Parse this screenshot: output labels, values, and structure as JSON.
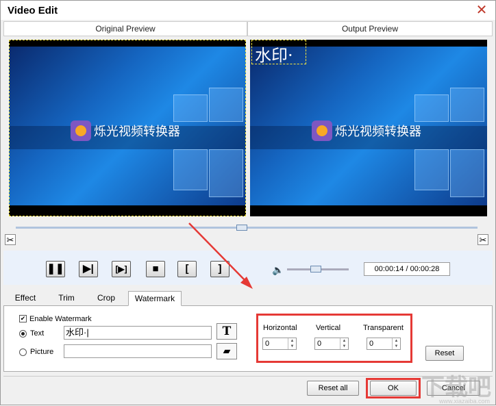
{
  "window": {
    "title": "Video Edit",
    "close_glyph": "✕"
  },
  "preview": {
    "original_label": "Original Preview",
    "output_label": "Output Preview",
    "brand_text": "烁光视频转换器",
    "watermark_text": "水印·"
  },
  "controls": {
    "pause": "❚❚",
    "play_frame": "▶|",
    "next_frame": "[▶]",
    "stop": "■",
    "mark_in": "[",
    "mark_out": "]",
    "volume_icon": "🔈",
    "time_display": "00:00:14 / 00:00:28"
  },
  "tabs": [
    {
      "label": "Effect"
    },
    {
      "label": "Trim"
    },
    {
      "label": "Crop"
    },
    {
      "label": "Watermark"
    }
  ],
  "active_tab": "Watermark",
  "watermark": {
    "enable_label": "Enable Watermark",
    "enable_checked": "✔",
    "text_label": "Text",
    "text_value": "水印·|",
    "picture_label": "Picture",
    "picture_value": "",
    "font_button": "T",
    "folder_glyph": "▰",
    "horizontal_label": "Horizontal",
    "horizontal_value": "0",
    "vertical_label": "Vertical",
    "vertical_value": "0",
    "transparent_label": "Transparent",
    "transparent_value": "0",
    "spin_up": "▲",
    "spin_down": "▼",
    "reset_label": "Reset"
  },
  "footer": {
    "reset_all_label": "Reset all",
    "ok_label": "OK",
    "cancel_label": "Cancel"
  },
  "overlay": {
    "site_mark": "下载吧",
    "site_url": "www.xiazaiba.com"
  },
  "colors": {
    "highlight_red": "#e53935",
    "selection_yellow": "#ffeb3b",
    "screen_blue": "#1565c0"
  }
}
